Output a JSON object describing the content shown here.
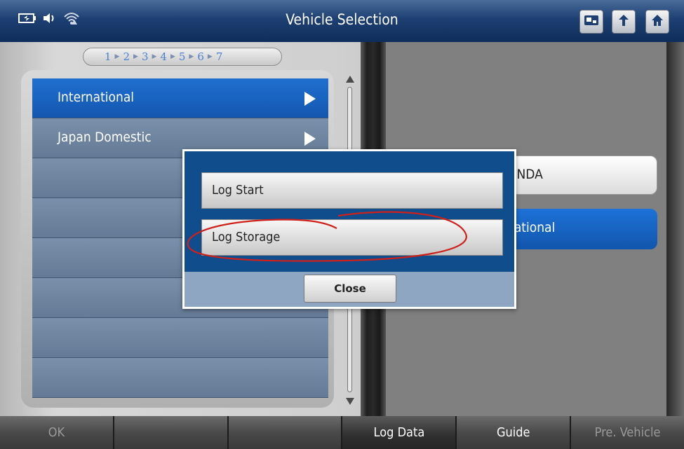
{
  "header": {
    "title": "Vehicle Selection",
    "status_icons": [
      "battery-icon",
      "speaker-icon",
      "wifi-icon"
    ],
    "buttons": [
      "screenshot-icon",
      "back-icon",
      "home-icon"
    ]
  },
  "breadcrumb": {
    "steps": [
      "1",
      "2",
      "3",
      "4",
      "5",
      "6",
      "7"
    ],
    "current": "1"
  },
  "list": {
    "items": [
      {
        "label": "International",
        "selected": true
      },
      {
        "label": "Japan Domestic",
        "selected": false
      }
    ],
    "empty_rows": 6
  },
  "right_pane": {
    "brand_label": "ONDA",
    "region_label": "national"
  },
  "dialog": {
    "buttons": [
      "Log Start",
      "Log Storage"
    ],
    "close_label": "Close"
  },
  "footer": {
    "buttons": [
      {
        "label": "OK",
        "enabled": false
      },
      {
        "label": "",
        "enabled": true
      },
      {
        "label": "",
        "enabled": true
      },
      {
        "label": "Log Data",
        "enabled": true
      },
      {
        "label": "Guide",
        "enabled": true
      },
      {
        "label": "Pre. Vehicle",
        "enabled": false
      }
    ]
  },
  "colors": {
    "header": "#1d3f72",
    "selected_row": "#1f6fd0",
    "dialog_body": "#0f4d8c",
    "annotation": "#d0201a"
  }
}
